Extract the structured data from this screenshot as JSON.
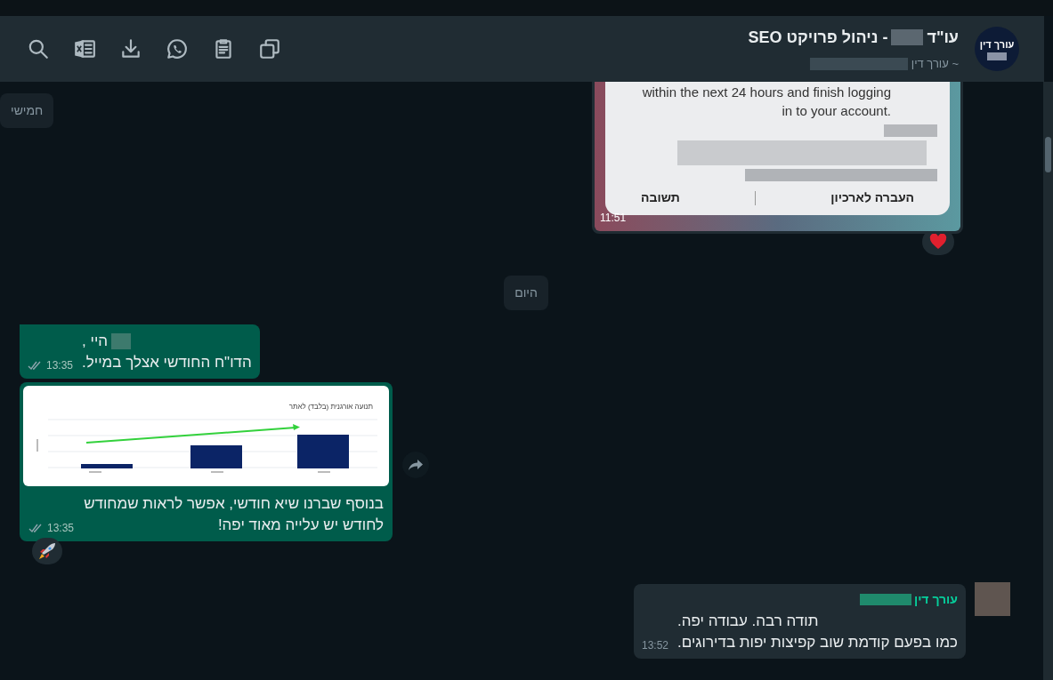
{
  "header": {
    "avatar_text": "עורך דין",
    "title": "עו\"ד",
    "title_rest": "- ניהול פרויקט SEO",
    "subtitle": "~ עורך דין"
  },
  "messages": [
    {
      "kind": "email_image",
      "outgoing": false,
      "lines": [
        "within the next 24 hours and finish logging",
        "in to your account."
      ],
      "actions": [
        "העברה לארכיון",
        "תשובה"
      ],
      "time": "11:51",
      "reaction": {
        "kind": "heart"
      }
    },
    {
      "kind": "date",
      "text": "חמישי"
    },
    {
      "kind": "date",
      "text": "היום"
    },
    {
      "kind": "text",
      "outgoing": true,
      "lines": [
        "היי ,",
        "הדו\"ח החודשי אצלך במייל."
      ],
      "time": "13:35",
      "read": false
    },
    {
      "kind": "chart_image",
      "outgoing": true,
      "chart_title": "תנועה אורגנית (בלבד) לאתר",
      "lines": [
        "בנוסף שברנו שיא חודשי, אפשר לראות שמחודש",
        "לחודש יש עלייה מאוד יפה!"
      ],
      "time": "13:35",
      "read": false,
      "reaction": {
        "kind": "rocket"
      }
    },
    {
      "kind": "text",
      "outgoing": false,
      "sender": "עורך דין",
      "lines": [
        "תודה רבה. עבודה יפה.",
        "כמו בפעם קודמת שוב קפיצות יפות בדירוגים."
      ],
      "time": "13:52"
    }
  ]
}
